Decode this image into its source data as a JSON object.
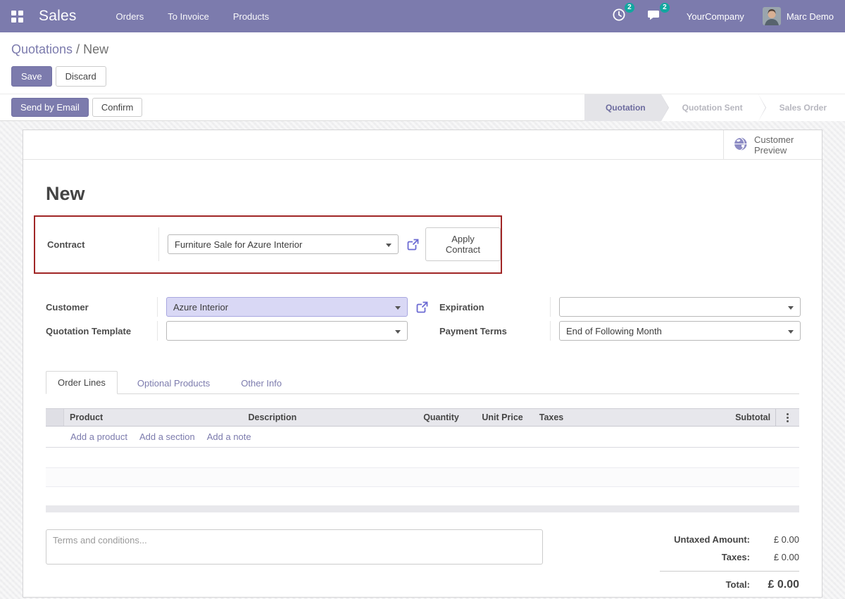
{
  "navbar": {
    "app_name": "Sales",
    "menus": [
      "Orders",
      "To Invoice",
      "Products"
    ],
    "activities_badge": "2",
    "messages_badge": "2",
    "company": "YourCompany",
    "user": "Marc Demo"
  },
  "breadcrumb": {
    "parent": "Quotations",
    "separator": " / ",
    "current": "New"
  },
  "actions": {
    "save": "Save",
    "discard": "Discard"
  },
  "statusbar": {
    "send_by_email": "Send by Email",
    "confirm": "Confirm",
    "stages": [
      {
        "label": "Quotation",
        "active": true
      },
      {
        "label": "Quotation Sent",
        "active": false
      },
      {
        "label": "Sales Order",
        "active": false
      }
    ]
  },
  "sheet": {
    "preview_button_label": "Customer Preview",
    "title": "New",
    "contract": {
      "label": "Contract",
      "value": "Furniture Sale for Azure Interior",
      "apply_button": "Apply Contract",
      "highlight_color": "#a02626"
    },
    "fields": {
      "customer": {
        "label": "Customer",
        "value": "Azure Interior"
      },
      "quotation_template": {
        "label": "Quotation Template",
        "value": ""
      },
      "expiration": {
        "label": "Expiration",
        "value": ""
      },
      "payment_terms": {
        "label": "Payment Terms",
        "value": "End of Following Month"
      }
    },
    "tabs": [
      {
        "label": "Order Lines"
      },
      {
        "label": "Optional Products"
      },
      {
        "label": "Other Info"
      }
    ],
    "order_lines": {
      "columns": [
        "Product",
        "Description",
        "Quantity",
        "Unit Price",
        "Taxes",
        "Subtotal"
      ],
      "add_links": [
        "Add a product",
        "Add a section",
        "Add a note"
      ]
    },
    "notes_placeholder": "Terms and conditions...",
    "totals": {
      "untaxed_label": "Untaxed Amount:",
      "untaxed_value": "£ 0.00",
      "taxes_label": "Taxes:",
      "taxes_value": "£ 0.00",
      "total_label": "Total:",
      "total_value": "£ 0.00"
    }
  },
  "colors": {
    "navbar": "#7c7bad",
    "badge": "#12a7a0",
    "link": "#7c7bad"
  }
}
